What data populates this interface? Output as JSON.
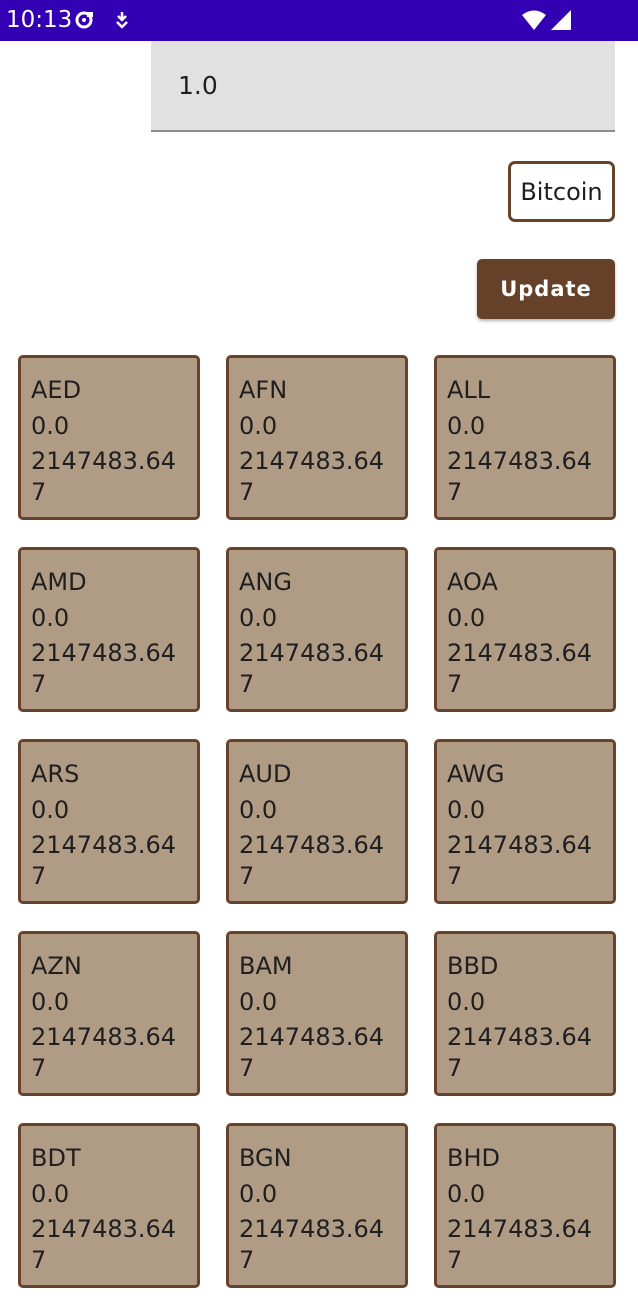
{
  "status_bar": {
    "time": "10:13"
  },
  "amount_input": {
    "value": "1.0"
  },
  "currency_select": {
    "selected": "Bitcoin"
  },
  "update_button": {
    "label": "Update"
  },
  "currencies": [
    {
      "code": "AED",
      "amount": "0.0",
      "rate": "2147483.647"
    },
    {
      "code": "AFN",
      "amount": "0.0",
      "rate": "2147483.647"
    },
    {
      "code": "ALL",
      "amount": "0.0",
      "rate": "2147483.647"
    },
    {
      "code": "AMD",
      "amount": "0.0",
      "rate": "2147483.647"
    },
    {
      "code": "ANG",
      "amount": "0.0",
      "rate": "2147483.647"
    },
    {
      "code": "AOA",
      "amount": "0.0",
      "rate": "2147483.647"
    },
    {
      "code": "ARS",
      "amount": "0.0",
      "rate": "2147483.647"
    },
    {
      "code": "AUD",
      "amount": "0.0",
      "rate": "2147483.647"
    },
    {
      "code": "AWG",
      "amount": "0.0",
      "rate": "2147483.647"
    },
    {
      "code": "AZN",
      "amount": "0.0",
      "rate": "2147483.647"
    },
    {
      "code": "BAM",
      "amount": "0.0",
      "rate": "2147483.647"
    },
    {
      "code": "BBD",
      "amount": "0.0",
      "rate": "2147483.647"
    },
    {
      "code": "BDT",
      "amount": "0.0",
      "rate": "2147483.647"
    },
    {
      "code": "BGN",
      "amount": "0.0",
      "rate": "2147483.647"
    },
    {
      "code": "BHD",
      "amount": "0.0",
      "rate": "2147483.647"
    }
  ]
}
